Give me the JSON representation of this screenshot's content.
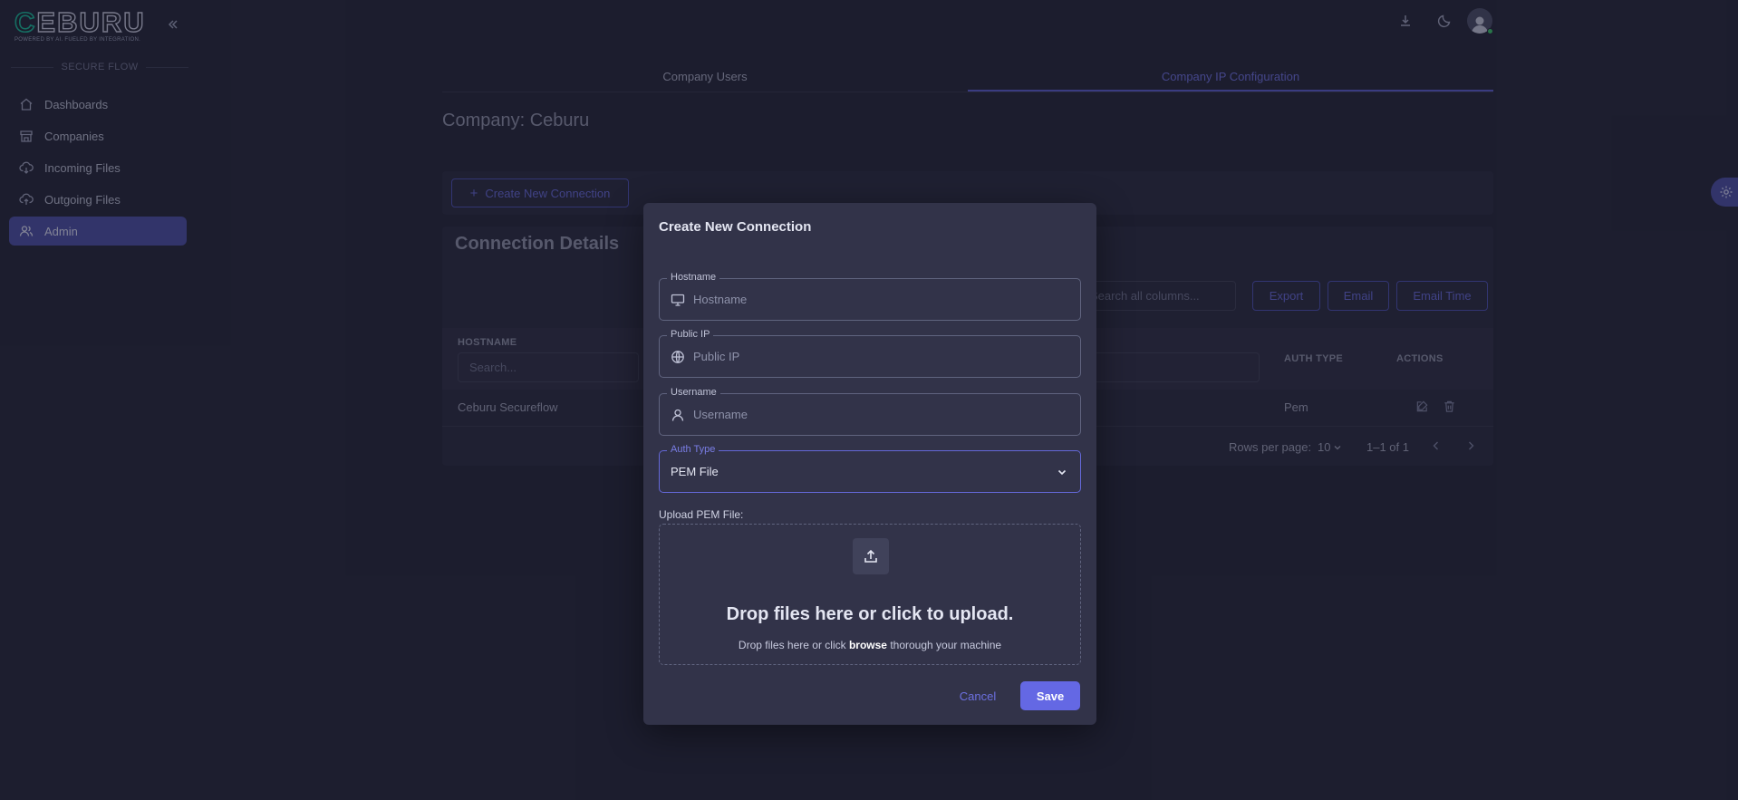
{
  "brand": {
    "logo_main": "CEBURU",
    "logo_tagline": "POWERED BY AI. FUELED BY INTEGRATION."
  },
  "sidebar": {
    "section_label": "SECURE FLOW",
    "items": [
      {
        "label": "Dashboards",
        "icon": "home-icon"
      },
      {
        "label": "Companies",
        "icon": "store-icon"
      },
      {
        "label": "Incoming Files",
        "icon": "cloud-download-icon"
      },
      {
        "label": "Outgoing Files",
        "icon": "cloud-upload-icon"
      },
      {
        "label": "Admin",
        "icon": "users-icon",
        "active": true
      }
    ]
  },
  "tabs": [
    {
      "label": "Company Users",
      "active": false
    },
    {
      "label": "Company IP Configuration",
      "active": true
    }
  ],
  "page": {
    "company_title": "Company: Ceburu",
    "create_button": "Create New Connection",
    "details_title": "Connection Details",
    "global_search_placeholder": "Search all columns...",
    "export_button": "Export",
    "email_button": "Email",
    "email_time_button": "Email Time"
  },
  "table": {
    "columns": {
      "hostname": "HOSTNAME",
      "auth_type": "AUTH TYPE",
      "actions": "ACTIONS"
    },
    "column_search_placeholder": "Search...",
    "rows": [
      {
        "hostname": "Ceburu Secureflow",
        "auth_type": "Pem"
      }
    ],
    "pagination": {
      "rows_per_page_label": "Rows per page:",
      "rows_per_page": "10",
      "range": "1–1 of 1"
    }
  },
  "modal": {
    "title": "Create New Connection",
    "hostname": {
      "label": "Hostname",
      "placeholder": "Hostname"
    },
    "public_ip": {
      "label": "Public IP",
      "placeholder": "Public IP"
    },
    "username": {
      "label": "Username",
      "placeholder": "Username"
    },
    "auth_type": {
      "label": "Auth Type",
      "value": "PEM File"
    },
    "upload_label": "Upload PEM File:",
    "drop_heading": "Drop files here or click to upload.",
    "drop_sub_pre": "Drop files here or click",
    "drop_sub_link": "browse",
    "drop_sub_post": "thorough your machine",
    "cancel": "Cancel",
    "save": "Save"
  },
  "colors": {
    "accent": "#6468e4",
    "sidebar_active": "#4b4fa7",
    "background": "#24253a",
    "modal_bg": "#323349",
    "online": "#3bc46a"
  }
}
